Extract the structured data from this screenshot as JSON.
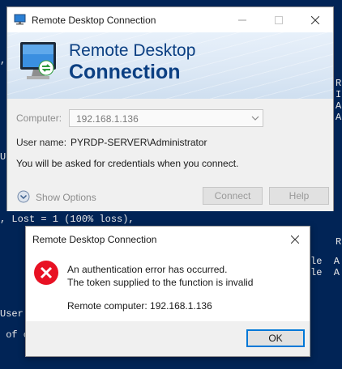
{
  "console": {
    "lines": {
      "l1": ",",
      "l2": "U",
      "l3": ", Lost = 1 (100% loss),",
      "l4": "User",
      "l5": " of c",
      "r1": "R",
      "r2": "I",
      "r3": "A",
      "r4": "A",
      "r5": "R",
      "r6": "le  A",
      "r7": "le  A"
    }
  },
  "rdc_window": {
    "title": "Remote Desktop Connection",
    "banner_line1": "Remote Desktop",
    "banner_line2": "Connection",
    "computer_label": "Computer:",
    "computer_value": "192.168.1.136",
    "username_label": "User name:",
    "username_value": "PYRDP-SERVER\\Administrator",
    "credentials_note": "You will be asked for credentials when you connect.",
    "show_options_label": "Show Options",
    "connect_label": "Connect",
    "help_label": "Help"
  },
  "error_dialog": {
    "title": "Remote Desktop Connection",
    "message_line1": "An authentication error has occurred.",
    "message_line2": "The token supplied to the function is invalid",
    "remote_computer": "Remote computer: 192.168.1.136",
    "ok_label": "OK"
  },
  "colors": {
    "console_bg": "#012456",
    "banner_text": "#0b3f82",
    "error_red": "#e81123",
    "focus_blue": "#0078d7"
  }
}
